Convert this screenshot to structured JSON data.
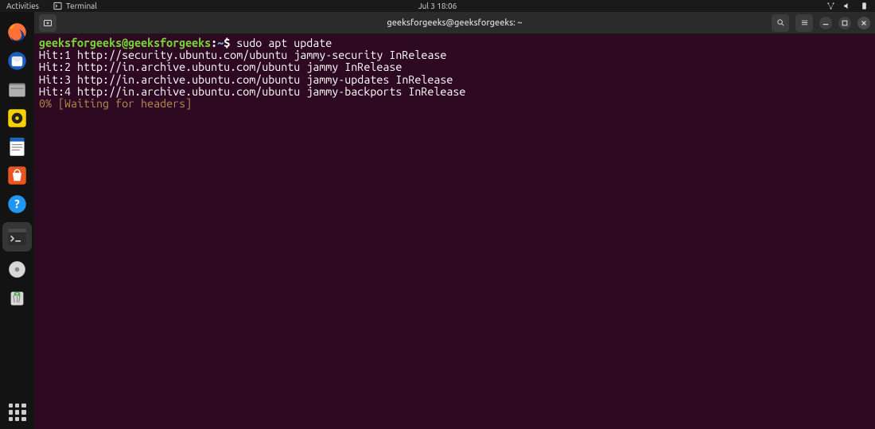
{
  "topbar": {
    "activities": "Activities",
    "app_label": "Terminal",
    "datetime": "Jul 3  18:06"
  },
  "dock": {
    "items": [
      {
        "name": "firefox"
      },
      {
        "name": "thunderbird"
      },
      {
        "name": "files"
      },
      {
        "name": "rhythmbox"
      },
      {
        "name": "libreoffice-writer"
      },
      {
        "name": "ubuntu-software"
      },
      {
        "name": "help"
      },
      {
        "name": "terminal"
      },
      {
        "name": "disk"
      },
      {
        "name": "trash"
      }
    ]
  },
  "window": {
    "title": "geeksforgeeks@geeksforgeeks: ~"
  },
  "terminal": {
    "prompt": {
      "user_host": "geeksforgeeks@geeksforgeeks",
      "colon": ":",
      "path": "~",
      "sigil": "$ "
    },
    "command": "sudo apt update",
    "output": [
      "Hit:1 http://security.ubuntu.com/ubuntu jammy-security InRelease",
      "Hit:2 http://in.archive.ubuntu.com/ubuntu jammy InRelease",
      "Hit:3 http://in.archive.ubuntu.com/ubuntu jammy-updates InRelease",
      "Hit:4 http://in.archive.ubuntu.com/ubuntu jammy-backports InRelease"
    ],
    "progress": "0% [Waiting for headers]"
  }
}
